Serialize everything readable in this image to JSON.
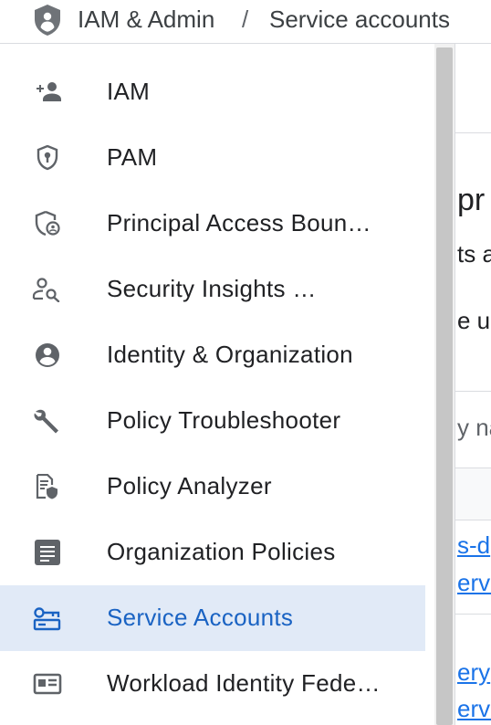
{
  "header": {
    "product": "IAM & Admin",
    "separator": "/",
    "page": "Service accounts"
  },
  "sidebar": {
    "items": [
      {
        "label": "IAM",
        "icon": "person-add-icon",
        "active": false
      },
      {
        "label": "PAM",
        "icon": "shield-lock-icon",
        "active": false
      },
      {
        "label": "Principal Access Boun…",
        "icon": "shield-person-icon",
        "active": false
      },
      {
        "label": "Security Insights …",
        "icon": "person-search-icon",
        "active": false
      },
      {
        "label": "Identity & Organization",
        "icon": "account-circle-icon",
        "active": false
      },
      {
        "label": "Policy Troubleshooter",
        "icon": "wrench-icon",
        "active": false
      },
      {
        "label": "Policy Analyzer",
        "icon": "document-shield-icon",
        "active": false
      },
      {
        "label": "Organization Policies",
        "icon": "list-document-icon",
        "active": false
      },
      {
        "label": "Service Accounts",
        "icon": "service-account-key-icon",
        "active": true
      },
      {
        "label": "Workload Identity Fede…",
        "icon": "id-card-icon",
        "active": false
      }
    ]
  },
  "content": {
    "heading_fragment": "pr",
    "line1_fragment": "ts a",
    "line2_fragment": "e u",
    "filter_fragment": "y na",
    "row1_link1": "s-d",
    "row1_link2": "ervic",
    "row2_link1": "ery",
    "row2_link2": "ervic"
  },
  "colors": {
    "active_bg": "#e1eaf7",
    "active_text": "#1a63c3",
    "link": "#1a73e8",
    "icon": "#5f6368"
  }
}
